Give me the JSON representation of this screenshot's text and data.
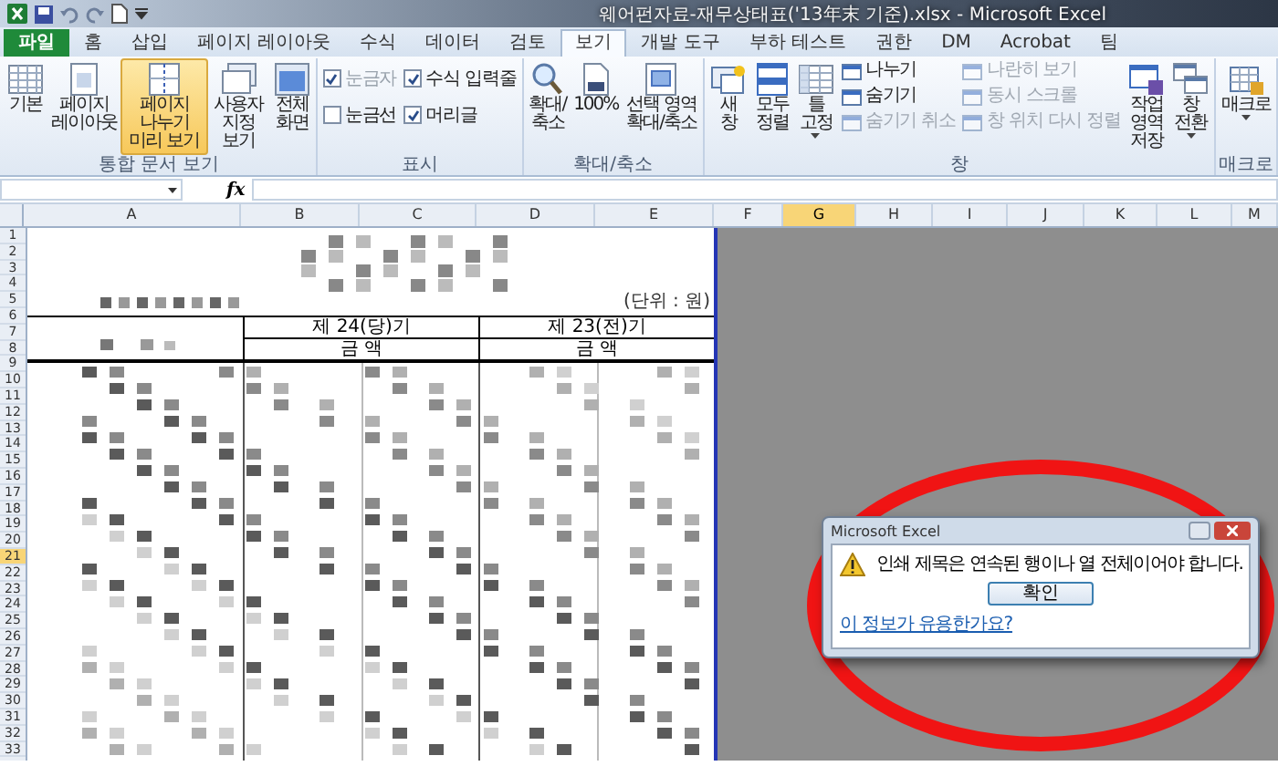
{
  "window": {
    "title": "웨어펀자료-재무상태표('13年末 기준).xlsx - Microsoft Excel"
  },
  "tabs": [
    {
      "label": "파일",
      "kind": "file",
      "selected": false
    },
    {
      "label": "홈",
      "kind": "tab",
      "selected": false
    },
    {
      "label": "삽입",
      "kind": "tab",
      "selected": false
    },
    {
      "label": "페이지 레이아웃",
      "kind": "tab",
      "selected": false
    },
    {
      "label": "수식",
      "kind": "tab",
      "selected": false
    },
    {
      "label": "데이터",
      "kind": "tab",
      "selected": false
    },
    {
      "label": "검토",
      "kind": "tab",
      "selected": false
    },
    {
      "label": "보기",
      "kind": "tab",
      "selected": true
    },
    {
      "label": "개발 도구",
      "kind": "tab",
      "selected": false
    },
    {
      "label": "부하 테스트",
      "kind": "tab",
      "selected": false
    },
    {
      "label": "권한",
      "kind": "tab",
      "selected": false
    },
    {
      "label": "DM",
      "kind": "tab",
      "selected": false
    },
    {
      "label": "Acrobat",
      "kind": "tab",
      "selected": false
    },
    {
      "label": "팀",
      "kind": "tab",
      "selected": false
    }
  ],
  "ribbon": {
    "groups": [
      {
        "label": "통합 문서 보기",
        "items": [
          {
            "kind": "large",
            "label": "기본",
            "selected": false,
            "dropdown": false
          },
          {
            "kind": "large",
            "label": "페이지 레이아웃",
            "selected": false,
            "dropdown": false
          },
          {
            "kind": "large",
            "label": "페이지 나누기 미리 보기",
            "selected": true,
            "dropdown": false
          },
          {
            "kind": "large",
            "label": "사용자 지정 보기",
            "selected": false,
            "dropdown": false
          },
          {
            "kind": "large",
            "label": "전체 화면",
            "selected": false,
            "dropdown": false
          }
        ]
      },
      {
        "label": "표시",
        "items": [
          {
            "kind": "checks",
            "checks": [
              {
                "label": "눈금자",
                "checked": true,
                "disabled": true
              },
              {
                "label": "눈금선",
                "checked": false,
                "disabled": false
              },
              {
                "label": "수식 입력줄",
                "checked": true,
                "disabled": false
              },
              {
                "label": "머리글",
                "checked": true,
                "disabled": false
              }
            ]
          }
        ]
      },
      {
        "label": "확대/축소",
        "items": [
          {
            "kind": "large",
            "label": "확대/축소",
            "selected": false,
            "dropdown": false
          },
          {
            "kind": "large",
            "label": "100%",
            "selected": false,
            "dropdown": false
          },
          {
            "kind": "large",
            "label": "선택 영역 확대/축소",
            "selected": false,
            "dropdown": false
          }
        ]
      },
      {
        "label": "창",
        "items": [
          {
            "kind": "large",
            "label": "새 창",
            "selected": false,
            "dropdown": false
          },
          {
            "kind": "large",
            "label": "모두 정렬",
            "selected": false,
            "dropdown": false
          },
          {
            "kind": "large",
            "label": "틀 고정",
            "selected": false,
            "dropdown": true
          },
          {
            "kind": "stack",
            "buttons": [
              {
                "label": "나누기",
                "disabled": false
              },
              {
                "label": "숨기기",
                "disabled": false
              },
              {
                "label": "숨기기 취소",
                "disabled": true
              }
            ]
          },
          {
            "kind": "stack",
            "buttons": [
              {
                "label": "나란히 보기",
                "disabled": true
              },
              {
                "label": "동시 스크롤",
                "disabled": true
              },
              {
                "label": "창 위치 다시 정렬",
                "disabled": true
              }
            ]
          },
          {
            "kind": "large",
            "label": "작업 영역 저장",
            "selected": false,
            "dropdown": false
          },
          {
            "kind": "large",
            "label": "창 전환",
            "selected": false,
            "dropdown": true
          }
        ]
      },
      {
        "label": "매크로",
        "items": [
          {
            "kind": "large",
            "label": "매크로",
            "selected": false,
            "dropdown": true
          }
        ]
      }
    ]
  },
  "formula_bar": {
    "fx": "fx"
  },
  "sheet": {
    "columns": [
      {
        "label": "A",
        "selected": false
      },
      {
        "label": "B",
        "selected": false
      },
      {
        "label": "C",
        "selected": false
      },
      {
        "label": "D",
        "selected": false
      },
      {
        "label": "E",
        "selected": false
      },
      {
        "label": "F",
        "selected": false
      },
      {
        "label": "G",
        "selected": true
      },
      {
        "label": "H",
        "selected": false
      },
      {
        "label": "I",
        "selected": false
      },
      {
        "label": "J",
        "selected": false
      },
      {
        "label": "K",
        "selected": false
      },
      {
        "label": "L",
        "selected": false
      },
      {
        "label": "M",
        "selected": false
      }
    ],
    "rows": [
      {
        "label": "1",
        "selected": false
      },
      {
        "label": "2",
        "selected": false
      },
      {
        "label": "3",
        "selected": false
      },
      {
        "label": "4",
        "selected": false
      },
      {
        "label": "5",
        "selected": false
      },
      {
        "label": "6",
        "selected": false
      },
      {
        "label": "7",
        "selected": false
      },
      {
        "label": "8",
        "selected": false
      },
      {
        "label": "9",
        "selected": false
      },
      {
        "label": "10",
        "selected": false
      },
      {
        "label": "11",
        "selected": false
      },
      {
        "label": "12",
        "selected": false
      },
      {
        "label": "13",
        "selected": false
      },
      {
        "label": "14",
        "selected": false
      },
      {
        "label": "15",
        "selected": false
      },
      {
        "label": "16",
        "selected": false
      },
      {
        "label": "17",
        "selected": false
      },
      {
        "label": "18",
        "selected": false
      },
      {
        "label": "19",
        "selected": false
      },
      {
        "label": "20",
        "selected": false
      },
      {
        "label": "21",
        "selected": true
      },
      {
        "label": "22",
        "selected": false
      },
      {
        "label": "23",
        "selected": false
      },
      {
        "label": "24",
        "selected": false
      },
      {
        "label": "25",
        "selected": false
      },
      {
        "label": "26",
        "selected": false
      },
      {
        "label": "27",
        "selected": false
      },
      {
        "label": "28",
        "selected": false
      },
      {
        "label": "29",
        "selected": false
      },
      {
        "label": "30",
        "selected": false
      },
      {
        "label": "31",
        "selected": false
      },
      {
        "label": "32",
        "selected": false
      },
      {
        "label": "33",
        "selected": false
      }
    ],
    "page": {
      "unit": "(단위 : 원)",
      "periods": [
        {
          "title": "제 24(당)기",
          "subtitle": "금 액"
        },
        {
          "title": "제 23(전)기",
          "subtitle": "금 액"
        }
      ]
    }
  },
  "dialog": {
    "title": "Microsoft Excel",
    "message": "인쇄 제목은 연속된 행이나 열 전체이어야 합니다.",
    "button": "확인",
    "help_link": "이 정보가 유용한가요?"
  }
}
